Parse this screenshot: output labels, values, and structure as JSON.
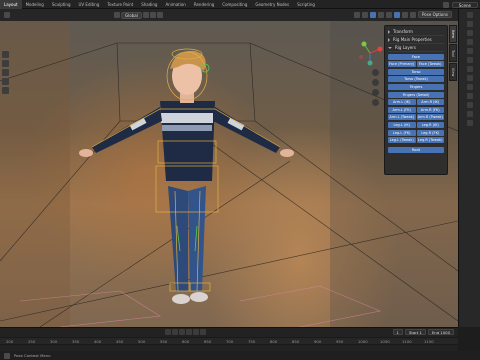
{
  "topbar": {
    "tabs": [
      "Layout",
      "Modeling",
      "Sculpting",
      "UV Editing",
      "Texture Paint",
      "Shading",
      "Animation",
      "Rendering",
      "Compositing",
      "Geometry Nodes",
      "Scripting"
    ],
    "scene_label": "Scene"
  },
  "header": {
    "mode_label": "Global",
    "pose_options_label": "Pose Options"
  },
  "npanel": {
    "sections": [
      "Transform",
      "Rig Main Properties",
      "Rig Layers"
    ],
    "buttons": {
      "face": "Face",
      "face_primary": "Face (Primary)",
      "face_tweak": "Face (Tweak)",
      "torso": "Torso",
      "torso_tweak": "Torso (Tweak)",
      "fingers": "Fingers",
      "fingers_detail": "Fingers (Detail)",
      "arm_l_ik": "Arm.L (IK)",
      "arm_r_ik": "Arm.R (IK)",
      "arm_l_fk": "Arm.L (FK)",
      "arm_r_fk": "Arm.R (FK)",
      "arm_l_tweak": "Arm.L (Tweak)",
      "arm_r_tweak": "Arm.R (Tweak)",
      "leg_l_ik": "Leg.L (IK)",
      "leg_r_ik": "Leg.R (IK)",
      "leg_l_fk": "Leg.L (FK)",
      "leg_r_fk": "Leg.R (FK)",
      "leg_l_tweak": "Leg.L (Tweak)",
      "leg_r_tweak": "Leg.R (Tweak)",
      "root": "Root"
    },
    "tabs": [
      "Item",
      "Tool",
      "View"
    ]
  },
  "timeline": {
    "current_frame": "1",
    "start_label": "Start",
    "start_value": "1",
    "end_label": "End",
    "end_value": "1000",
    "ticks": [
      "200",
      "250",
      "300",
      "350",
      "400",
      "450",
      "500",
      "550",
      "600",
      "650",
      "700",
      "750",
      "800",
      "850",
      "900",
      "950",
      "1000",
      "1050",
      "1100",
      "1150"
    ]
  },
  "status": {
    "text": "Pose Context Menu"
  },
  "colors": {
    "accent": "#4772b3",
    "bone_outline": "#e0b040",
    "bone_selected": "#50d050"
  }
}
